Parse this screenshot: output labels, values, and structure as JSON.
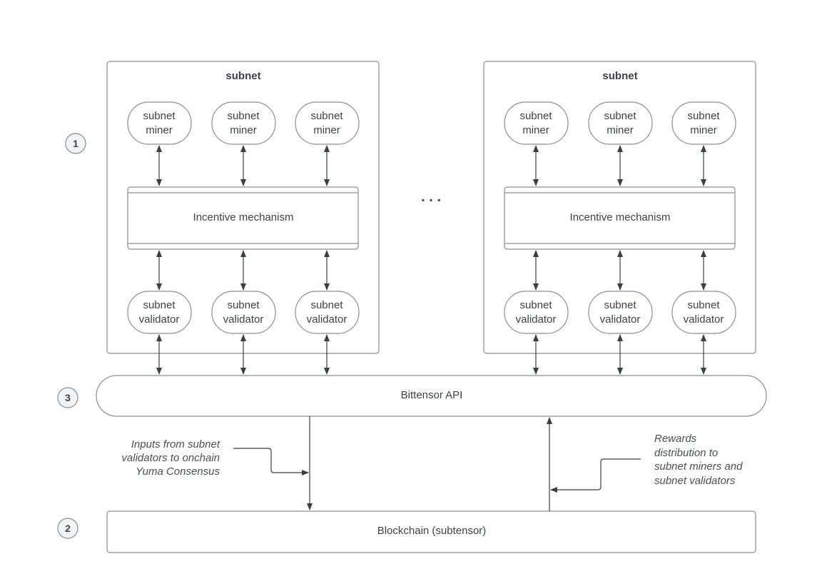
{
  "diagram": {
    "subnets": [
      {
        "title": "subnet",
        "miners": [
          {
            "line1": "subnet",
            "line2": "miner"
          },
          {
            "line1": "subnet",
            "line2": "miner"
          },
          {
            "line1": "subnet",
            "line2": "miner"
          }
        ],
        "mechanism": "Incentive mechanism",
        "validators": [
          {
            "line1": "subnet",
            "line2": "validator"
          },
          {
            "line1": "subnet",
            "line2": "validator"
          },
          {
            "line1": "subnet",
            "line2": "validator"
          }
        ]
      },
      {
        "title": "subnet",
        "miners": [
          {
            "line1": "subnet",
            "line2": "miner"
          },
          {
            "line1": "subnet",
            "line2": "miner"
          },
          {
            "line1": "subnet",
            "line2": "miner"
          }
        ],
        "mechanism": "Incentive mechanism",
        "validators": [
          {
            "line1": "subnet",
            "line2": "validator"
          },
          {
            "line1": "subnet",
            "line2": "validator"
          },
          {
            "line1": "subnet",
            "line2": "validator"
          }
        ]
      }
    ],
    "ellipsis": ". . .",
    "markers": [
      "1",
      "3",
      "2"
    ],
    "api_label": "Bittensor API",
    "blockchain_label": "Blockchain (subtensor)",
    "left_annotation": [
      "Inputs from subnet",
      "validators to onchain",
      "Yuma Consensus"
    ],
    "right_annotation": [
      "Rewards",
      "distribution to",
      "subnet miners and",
      "subnet validators"
    ]
  }
}
